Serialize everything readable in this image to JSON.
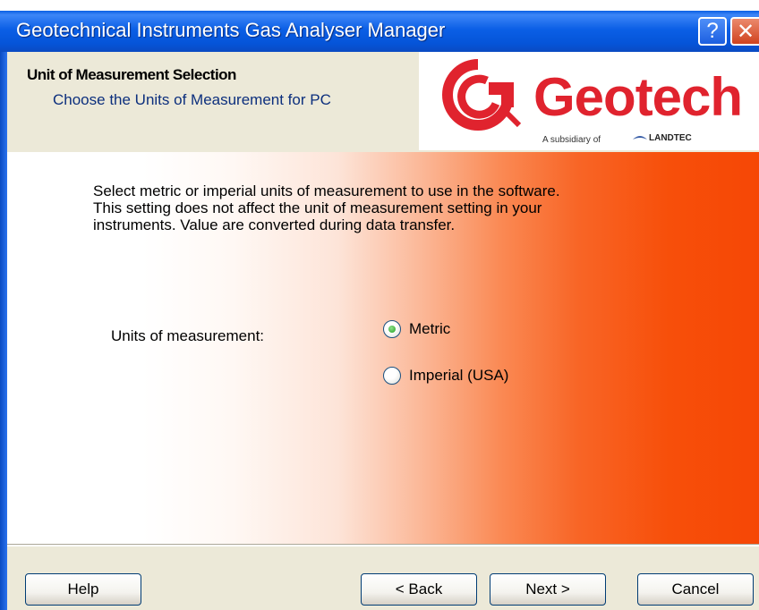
{
  "window": {
    "title": "Geotechnical Instruments Gas Analyser Manager",
    "help_button": "?",
    "close_button": "✕"
  },
  "header": {
    "title": "Unit of Measurement Selection",
    "subtitle": "Choose the Units of Measurement for PC"
  },
  "logo": {
    "brand": "Geotech",
    "tagline": "A subsidiary of",
    "parent": "LANDTEC"
  },
  "body": {
    "description_lines": [
      "Select metric or imperial units of measurement to use in the software.",
      "This setting does not affect the unit of measurement setting in your",
      "instruments. Value are converted during data transfer."
    ],
    "units_label": "Units of measurement:",
    "options": [
      {
        "label": "Metric",
        "selected": true
      },
      {
        "label": "Imperial (USA)",
        "selected": false
      }
    ]
  },
  "footer": {
    "help": "Help",
    "back": "< Back",
    "next": "Next >",
    "cancel": "Cancel"
  },
  "colors": {
    "titlebar": "#0b5fe6",
    "accent_orange": "#f64705",
    "brand_red": "#e0232e"
  }
}
